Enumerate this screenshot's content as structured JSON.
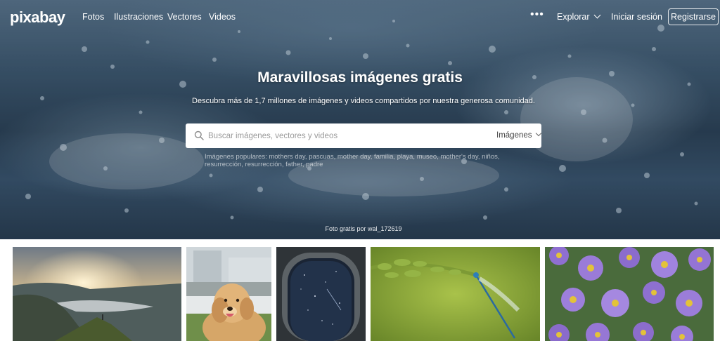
{
  "brand": {
    "logo_text": "pixabay"
  },
  "nav": {
    "links": [
      "Fotos",
      "Ilustraciones",
      "Vectores",
      "Videos"
    ],
    "more_label": "•••",
    "explore_label": "Explorar",
    "login_label": "Iniciar sesión",
    "register_label": "Registrarse"
  },
  "hero": {
    "title": "Maravillosas imágenes gratis",
    "subtitle": "Descubra más de 1,7 millones de imágenes y videos compartidos por nuestra generosa comunidad.",
    "search": {
      "placeholder": "Buscar imágenes, vectores y videos",
      "type_selected": "Imágenes"
    },
    "popular_text": "Imágenes populares: mothers day, pascuas, mother day, familia, playa, museo, mother's day, niños, resurrección, resurrección, father, padre",
    "credit": "Foto gratis por wal_172619"
  },
  "gallery": {
    "items": [
      {
        "name": "mountain-sunrise-photo"
      },
      {
        "name": "golden-retriever-photo"
      },
      {
        "name": "airplane-window-night-photo"
      },
      {
        "name": "dragonfly-on-plant-photo"
      },
      {
        "name": "purple-asters-photo"
      }
    ]
  },
  "colors": {
    "hero_dark": "#2d4358",
    "hero_light": "#5d7890",
    "nav_text": "#ffffff",
    "searchbar_bg": "#ffffff"
  }
}
